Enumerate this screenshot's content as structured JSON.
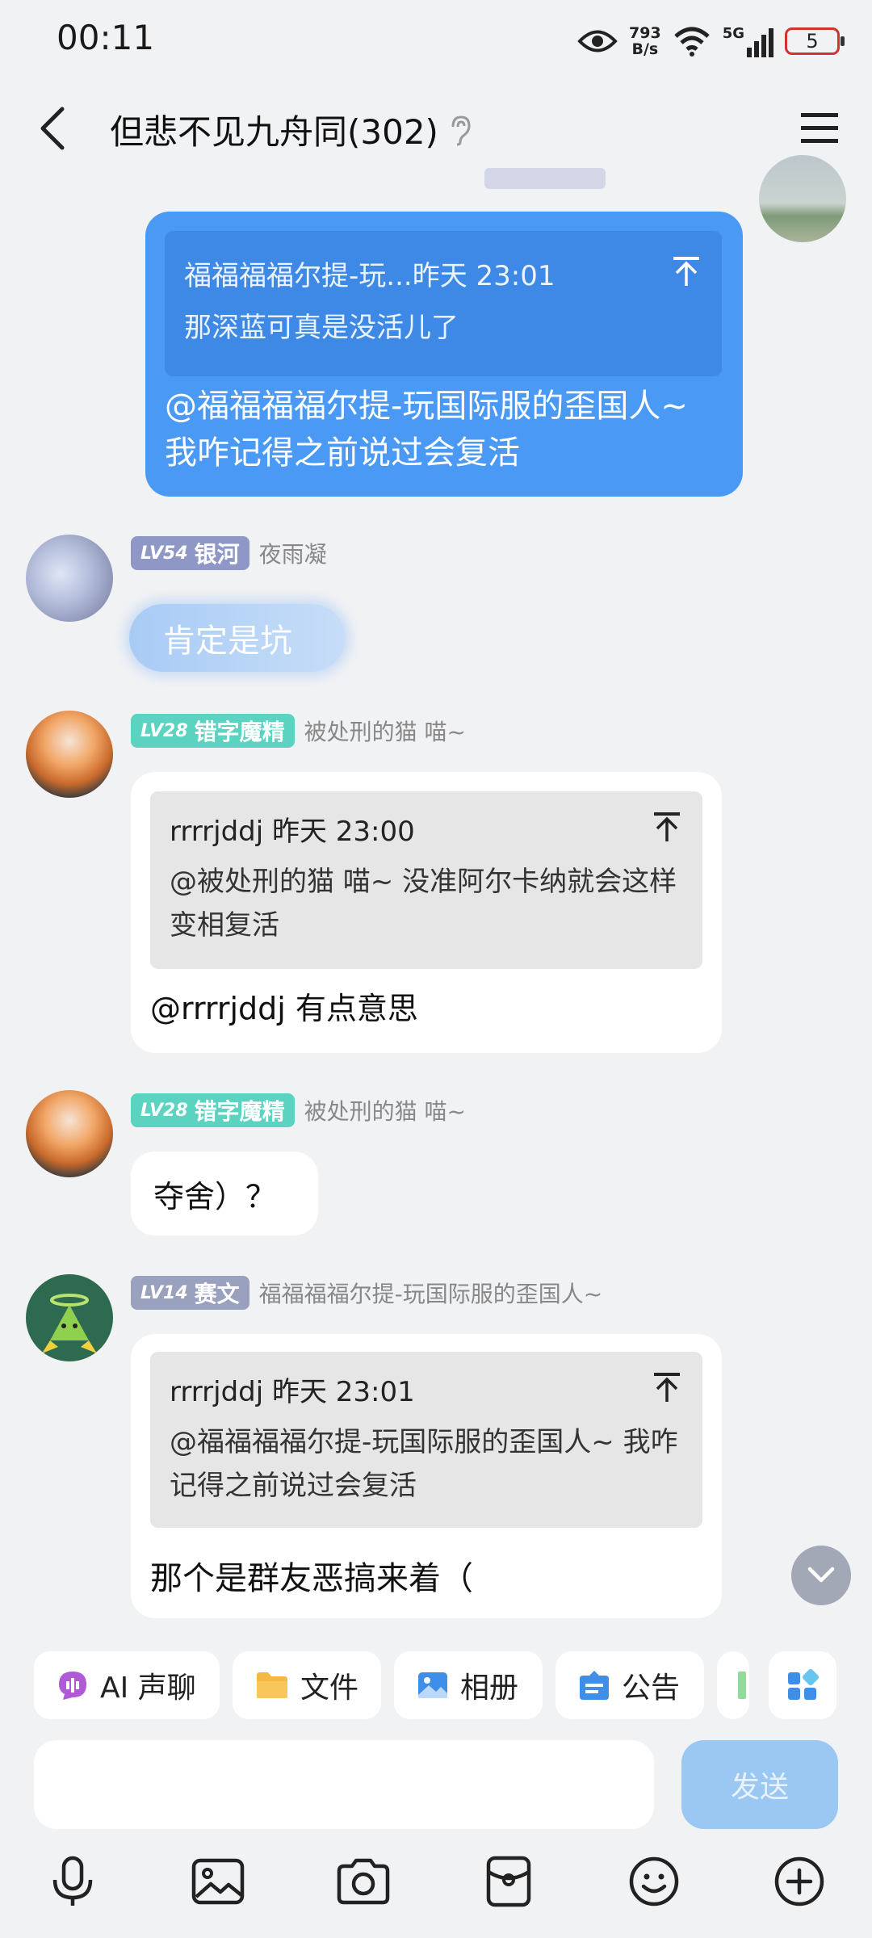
{
  "status_bar": {
    "time": "00:11",
    "net_speed_value": "793",
    "net_speed_unit": "B/s",
    "network": "5G",
    "battery": "5"
  },
  "header": {
    "title": "但悲不见九舟同(302)"
  },
  "messages": {
    "own": {
      "quote_author_time": "福福福福尔提-玩...昨天 23:01",
      "quote_text": "那深蓝可真是没活儿了",
      "text": "@福福福福尔提-玩国际服的歪国人~ 我咋记得之前说过会复活"
    },
    "m1": {
      "level": "LV54",
      "title": "银河",
      "name": "夜雨凝",
      "text": "肯定是坑"
    },
    "m2": {
      "level": "LV28",
      "title": "错字魔精",
      "name": "被处刑的猫 喵~",
      "quote_head": "rrrrjddj 昨天 23:00",
      "quote_text": "@被处刑的猫 喵~ 没准阿尔卡纳就会这样变相复活",
      "text": "@rrrrjddj 有点意思"
    },
    "m3": {
      "level": "LV28",
      "title": "错字魔精",
      "name": "被处刑的猫 喵~",
      "text": "夺舍）？"
    },
    "m4": {
      "level": "LV14",
      "title": "赛文",
      "name": "福福福福尔提-玩国际服的歪国人~",
      "quote_head": "rrrrjddj 昨天 23:01",
      "quote_text": "@福福福福尔提-玩国际服的歪国人~ 我咋记得之前说过会复活",
      "text": "那个是群友恶搞来着（"
    }
  },
  "quick_bar": {
    "ai_voice": "AI 声聊",
    "files": "文件",
    "album": "相册",
    "notice": "公告"
  },
  "input": {
    "send_label": "发送"
  },
  "colors": {
    "accent": "#4a9af5",
    "badge_galaxy": "#8f97c6",
    "badge_typo": "#5cd3c0",
    "badge_seven": "#9aa1bf"
  }
}
